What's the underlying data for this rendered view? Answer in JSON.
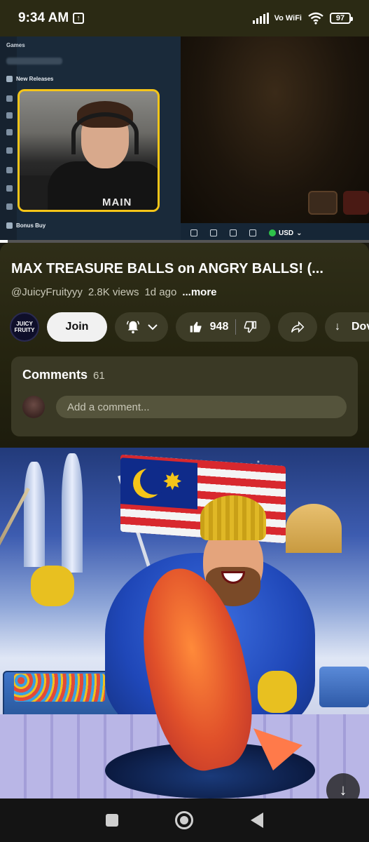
{
  "status_bar": {
    "time": "9:34 AM",
    "network": "Vo WiFi",
    "battery": "97"
  },
  "player": {
    "sidebar": {
      "section_label": "Games",
      "items": [
        {
          "label": "New Releases",
          "icon": "sparkle-icon"
        },
        {
          "label": "Bonus Buy",
          "icon": "gift-icon"
        }
      ]
    },
    "webcam_shirt_text": "MAIN",
    "currency": "USD",
    "progress_percent": 2
  },
  "video": {
    "title": "MAX TREASURE BALLS on ANGRY BALLS! (...",
    "channel": "@JuicyFruityyy",
    "views": "2.8K views",
    "age": "1d ago",
    "more_label": "...more",
    "channel_avatar_text": [
      "JUICY",
      "FRUITY"
    ],
    "join_label": "Join",
    "like_count": "948",
    "download_label": "Dov"
  },
  "comments": {
    "label": "Comments",
    "count": "61",
    "placeholder": "Add a comment..."
  },
  "colors": {
    "webcam_border": "#f5c518",
    "usd_badge": "#2ec24a",
    "panel_bg": "#2f2e18"
  }
}
